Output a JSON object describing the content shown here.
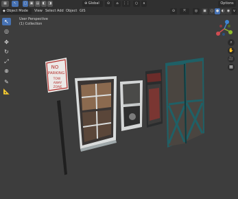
{
  "header": {
    "mode_label": "Object Mode",
    "menus": [
      "View",
      "Select",
      "Add",
      "Object",
      "GIS"
    ],
    "orientation_label": "Global",
    "options_label": "Options"
  },
  "viewport": {
    "view_name": "User Perspective",
    "collection": "(1) Collection"
  },
  "scene": {
    "sign_lines": [
      "NO",
      "PARKING",
      "TOW",
      "AWAY",
      "ZONE"
    ]
  },
  "colors": {
    "accent": "#4772b3",
    "background": "#3d3d3d",
    "header": "#303030"
  },
  "tools": [
    "select-box-icon",
    "cursor-icon",
    "move-icon",
    "rotate-icon",
    "scale-icon",
    "transform-icon",
    "annotate-icon",
    "measure-icon"
  ],
  "nav": [
    "zoom-icon",
    "pan-hand-icon",
    "camera-icon",
    "grid-view-icon"
  ]
}
